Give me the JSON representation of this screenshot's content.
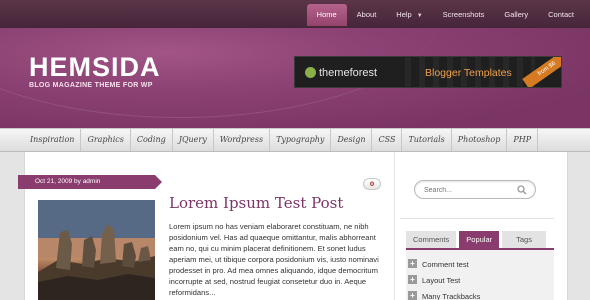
{
  "top_nav": {
    "items": [
      {
        "label": "Home",
        "active": true
      },
      {
        "label": "About"
      },
      {
        "label": "Help",
        "has_dropdown": true
      },
      {
        "label": "Screenshots"
      },
      {
        "label": "Gallery"
      },
      {
        "label": "Contact"
      }
    ]
  },
  "header": {
    "site_title": "HEMSIDA",
    "tagline": "BLOG MAGAZINE THEME FOR WP",
    "banner": {
      "brand": "themeforest",
      "text": "Blogger Templates",
      "ribbon": "from $6"
    }
  },
  "category_nav": {
    "items": [
      "Inspiration",
      "Graphics",
      "Coding",
      "JQuery",
      "Wordpress",
      "Typography",
      "Design",
      "CSS",
      "Tutorials",
      "Photoshop",
      "PHP"
    ]
  },
  "post": {
    "meta": "Oct 21, 2009 by admin",
    "comment_count": "0",
    "title": "Lorem Ipsum Test Post",
    "excerpt": "Lorem ipsum no has veniam elaboraret constituam, ne nibh posidonium vel. Has ad quaeque omittantur, malis abhorreant eam no, qui cu minim placerat definitionem. Et sonet ludus aperiam mei, ut tibique corpora posidonium vis, iusto nominavi prodesset in pro. Ad mea omnes aliquando, idque democritum incorrupte at sed, nostrud feugiat consetetur duo in. Aeque reformidans..."
  },
  "sidebar": {
    "search": {
      "placeholder": "Search..."
    },
    "tabs": [
      {
        "label": "Comments"
      },
      {
        "label": "Popular",
        "active": true
      },
      {
        "label": "Tags"
      }
    ],
    "popular_items": [
      "Comment test",
      "Layout Test",
      "Many Trackbacks"
    ]
  },
  "colors": {
    "accent": "#8a3c6e",
    "header_bg": "#8c4274",
    "top_bar": "#4e2b40"
  }
}
